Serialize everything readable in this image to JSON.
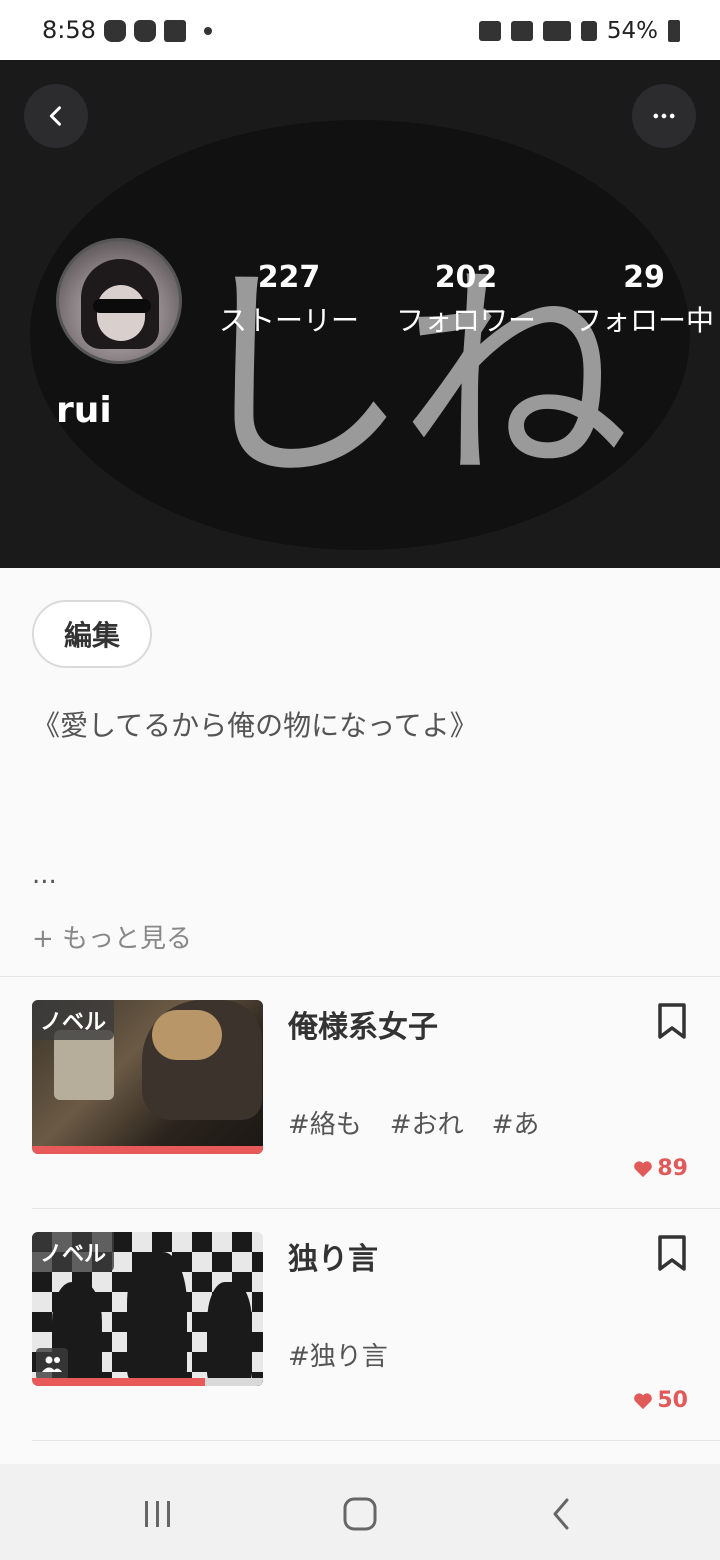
{
  "status_bar": {
    "time": "8:58",
    "battery": "54%",
    "icons": [
      "cat-app-icon",
      "cat-app-icon",
      "checkbox-icon",
      "dot-icon",
      "mute-icon",
      "wifi-icon",
      "volte-icon",
      "signal-icon",
      "battery-icon"
    ]
  },
  "header": {
    "background_text": "しね",
    "username": "rui",
    "stats": [
      {
        "value": "227",
        "label": "ストーリー"
      },
      {
        "value": "202",
        "label": "フォロワー"
      },
      {
        "value": "29",
        "label": "フォロー中"
      }
    ]
  },
  "profile": {
    "edit_label": "編集",
    "bio": "《愛してるから俺の物になってよ》",
    "ellipsis": "...",
    "more_label": "+ もっと見る"
  },
  "stories": [
    {
      "type_label": "ノベル",
      "title": "俺様系女子",
      "tags": [
        "#絡も",
        "#おれ",
        "#あ"
      ],
      "likes": "89",
      "progress": 1.0,
      "group_icon": false
    },
    {
      "type_label": "ノベル",
      "title": "独り言",
      "tags": [
        "#独り言"
      ],
      "likes": "50",
      "progress": 0.75,
      "group_icon": true
    }
  ],
  "colors": {
    "accent": "#e85a5a",
    "header_bg": "#1a1a1a",
    "page_bg": "#fafafa"
  }
}
